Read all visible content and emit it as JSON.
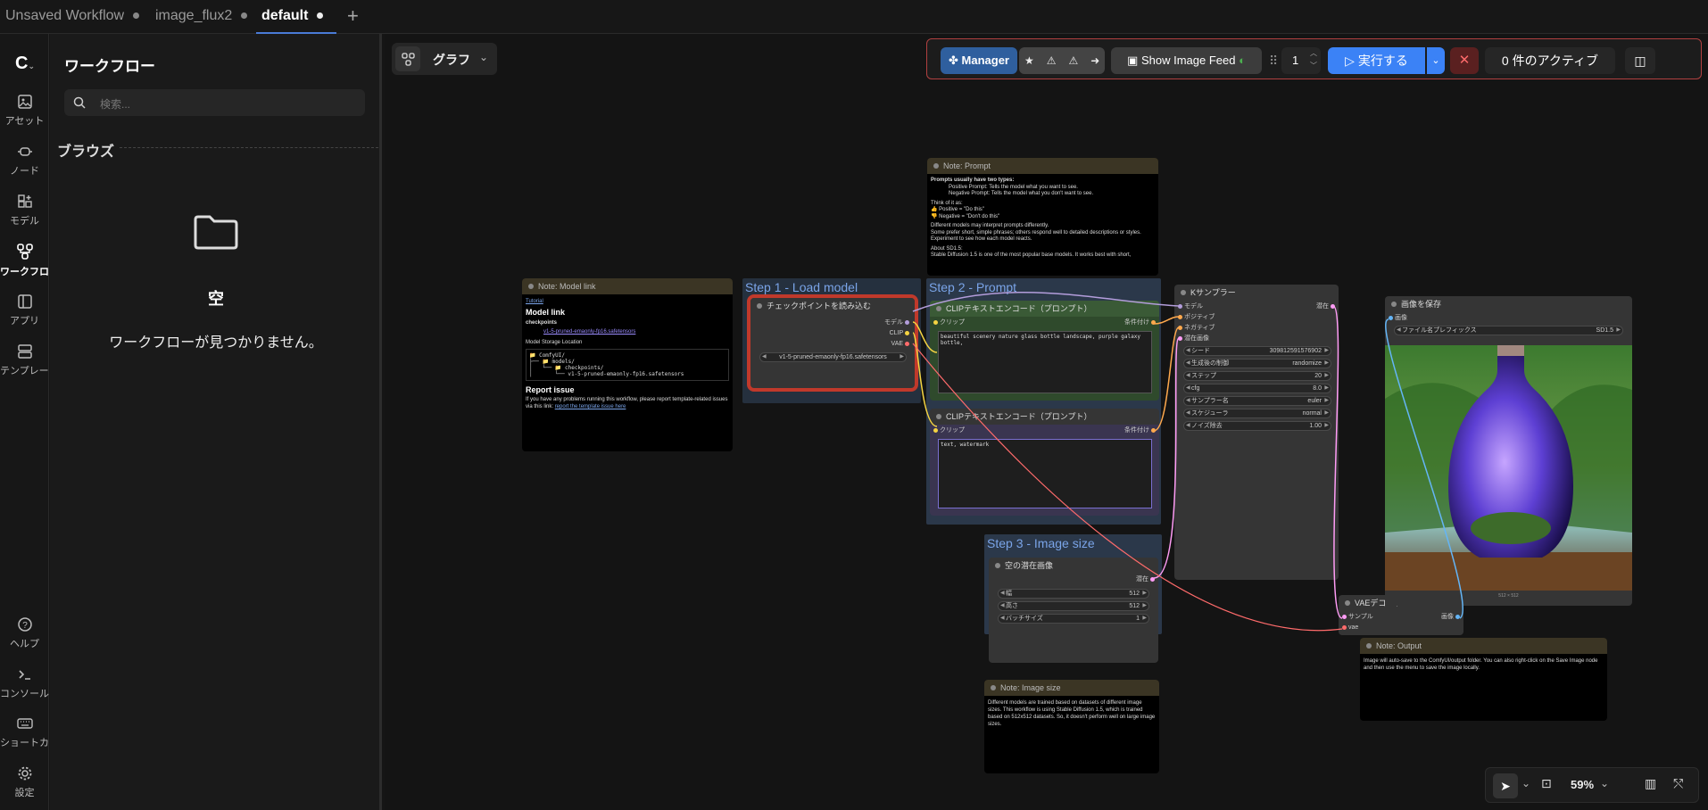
{
  "tabs": [
    {
      "label": "Unsaved Workflow"
    },
    {
      "label": "image_flux2"
    },
    {
      "label": "default"
    }
  ],
  "tab_add_icon": "+",
  "rail": [
    {
      "label": "アセット",
      "icon": "image-icon"
    },
    {
      "label": "ノード",
      "icon": "node-icon"
    },
    {
      "label": "モデル",
      "icon": "model-icon"
    },
    {
      "label": "ワークフロー",
      "icon": "workflow-icon"
    },
    {
      "label": "アプリ",
      "icon": "app-icon"
    },
    {
      "label": "テンプレート",
      "icon": "template-icon"
    },
    {
      "label": "ヘルプ",
      "icon": "help-icon"
    },
    {
      "label": "コンソール",
      "icon": "console-icon"
    },
    {
      "label": "ショートカ",
      "icon": "keyboard-icon"
    },
    {
      "label": "設定",
      "icon": "gear-icon"
    }
  ],
  "sidebar": {
    "title": "ワークフロー",
    "search_placeholder": "検索...",
    "browse_label": "ブラウズ",
    "empty_title": "空",
    "empty_message": "ワークフローが見つかりません。"
  },
  "canvas_toolbar": {
    "graph_label": "グラフ"
  },
  "top_toolbar": {
    "manager_label": "Manager",
    "feed_label": "Show Image Feed",
    "queue_count": "1",
    "run_label": "実行する",
    "active_label": "0 件のアクティブ"
  },
  "bottom_toolbar": {
    "zoom": "59%"
  },
  "groups": {
    "step1": "Step 1 - Load model",
    "step2": "Step 2 - Prompt",
    "step3": "Step 3 - Image size"
  },
  "note_model_link": {
    "title": "Note: Model link",
    "tutorial": "Tutorial",
    "heading": "Model link",
    "sub1": "checkpoints",
    "link1": "v1-5-pruned-emaonly-fp16.safetensors",
    "storage": "Model Storage Location",
    "tree1": "📁 ComfyUI/",
    "tree2": "├── 📁 models/",
    "tree3": "│   └── 📁 checkpoints/",
    "tree4": "│       └── v1-5-pruned-emaonly-fp16.safetensors",
    "report_heading": "Report issue",
    "report_text": "If you have any problems running this workflow, please report template-related issues via this link:",
    "report_link": "report the template issue here"
  },
  "checkpoint": {
    "title": "チェックポイントを読み込む",
    "out1": "モデル",
    "out2": "CLIP",
    "out3": "VAE",
    "value": "v1-5-pruned-emaonly-fp16.safetensors"
  },
  "note_prompt": {
    "title": "Note: Prompt",
    "l1": "Prompts usually have two types:",
    "l2": "Positive Prompt: Tells the model what you want to see.",
    "l3": "Negative Prompt: Tells the model what you don't want to see.",
    "l4": "Think of it as:",
    "l5": "👍 Positive = \"Do this\"",
    "l6": "👎 Negative = \"Don't do this\"",
    "l7": "Different models may interpret prompts differently.",
    "l8": "Some prefer short, simple phrases; others respond well to detailed descriptions or styles. Experiment to see how each model reacts.",
    "l9": "About SD1.5:",
    "l10": "Stable Diffusion 1.5 is one of the most popular base models. It works best with short,"
  },
  "clip_pos": {
    "title": "CLIPテキストエンコード（プロンプト）",
    "in": "クリップ",
    "out": "条件付け",
    "text": "beautiful scenery nature glass bottle landscape, purple galaxy bottle,"
  },
  "clip_neg": {
    "title": "CLIPテキストエンコード（プロンプト）",
    "in": "クリップ",
    "out": "条件付け",
    "text": "text, watermark"
  },
  "ksampler": {
    "title": "Kサンプラー",
    "inputs": [
      "モデル",
      "ポジティブ",
      "ネガティブ",
      "潜在画像"
    ],
    "out": "潜在",
    "widgets": [
      {
        "label": "シード",
        "value": "309812591576902"
      },
      {
        "label": "生成後の制御",
        "value": "randomize"
      },
      {
        "label": "ステップ",
        "value": "20"
      },
      {
        "label": "cfg",
        "value": "8.0"
      },
      {
        "label": "サンプラー名",
        "value": "euler"
      },
      {
        "label": "スケジューラ",
        "value": "normal"
      },
      {
        "label": "ノイズ除去",
        "value": "1.00"
      }
    ]
  },
  "latent": {
    "title": "空の潜在画像",
    "out": "潜在",
    "widgets": [
      {
        "label": "幅",
        "value": "512"
      },
      {
        "label": "高さ",
        "value": "512"
      },
      {
        "label": "バッチサイズ",
        "value": "1"
      }
    ]
  },
  "vae": {
    "title": "VAEデコード",
    "in1": "サンプル",
    "in2": "vae",
    "out": "画像"
  },
  "save": {
    "title": "画像を保存",
    "in": "画像",
    "prefix_label": "ファイル名プレフィックス",
    "prefix_value": "SD1.5",
    "size": "512 × 512"
  },
  "note_output": {
    "title": "Note: Output",
    "text": "Image will auto-save to the ComfyUI/output folder. You can also right-click on the Save Image node and then use the menu to save the image locally."
  },
  "note_size": {
    "title": "Note: Image size",
    "text": "Different models are trained based on datasets of different image sizes. This workflow is using Stable Diffusion 1.5, which is trained based on 512x512 datasets. So, it doesn't perform well on large image sizes."
  }
}
